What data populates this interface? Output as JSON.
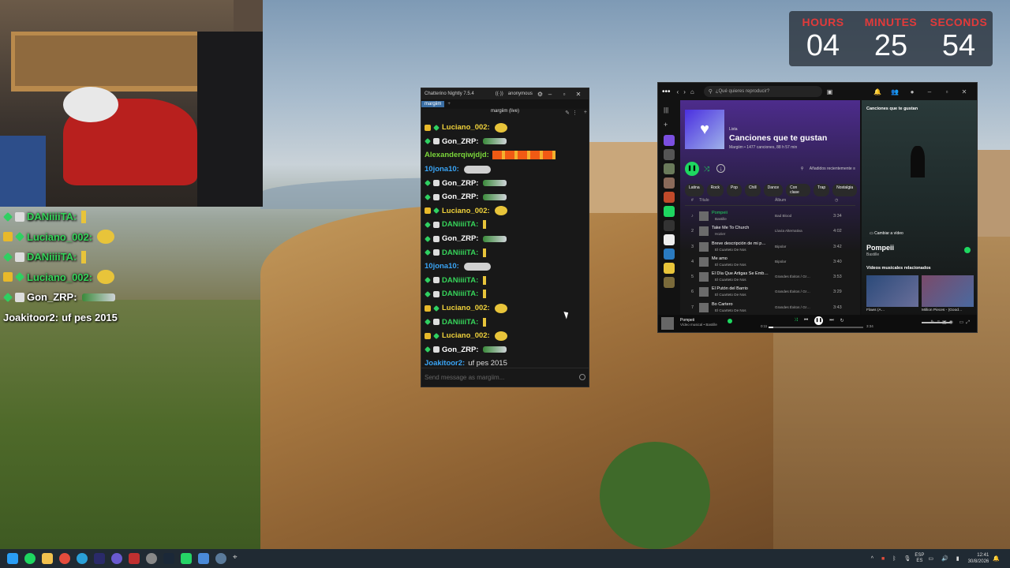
{
  "timer": {
    "hours_label": "HOURS",
    "hours": "04",
    "minutes_label": "MINUTES",
    "minutes": "25",
    "seconds_label": "SECONDS",
    "seconds": "54"
  },
  "overlay_chat": [
    {
      "user": "DANiiiiTA:",
      "color": "green",
      "badges": [
        "diamond",
        "bot"
      ],
      "emote": "slim"
    },
    {
      "user": "Luciano_002:",
      "color": "green",
      "badges": [
        "crown",
        "diamond"
      ],
      "emote": "face"
    },
    {
      "user": "DANiiiiTA:",
      "color": "green",
      "badges": [
        "diamond",
        "bot"
      ],
      "emote": "slim"
    },
    {
      "user": "Luciano_002:",
      "color": "green",
      "badges": [
        "crown",
        "diamond"
      ],
      "emote": "face"
    },
    {
      "user": "Gon_ZRP:",
      "color": "white",
      "badges": [
        "diamond",
        "bot"
      ],
      "emote": "gun"
    },
    {
      "user": "Joakitoor2:",
      "color": "white",
      "badges": [],
      "text": "uf pes 2015"
    }
  ],
  "chatterino": {
    "title": "Chatterino Nightly 7.5.4",
    "account": "anonymous",
    "tab": "margiim",
    "channel": "margiim (live)",
    "input_placeholder": "Send message as margiim...",
    "messages": [
      {
        "user": "Luciano_002:",
        "color": "yellow",
        "badges": [
          "crown",
          "diamond"
        ],
        "emote": "face"
      },
      {
        "user": "Gon_ZRP:",
        "color": "white",
        "badges": [
          "diamond",
          "bot"
        ],
        "emote": "gun"
      },
      {
        "user": "Alexanderqiwjdjd:",
        "color": "lime",
        "badges": [],
        "emote": "fire"
      },
      {
        "user": "10jona10:",
        "color": "blue",
        "badges": [],
        "emote": "cloud"
      },
      {
        "user": "Gon_ZRP:",
        "color": "white",
        "badges": [
          "diamond",
          "bot"
        ],
        "emote": "gun"
      },
      {
        "user": "Gon_ZRP:",
        "color": "white",
        "badges": [
          "diamond",
          "bot"
        ],
        "emote": "gun"
      },
      {
        "user": "Luciano_002:",
        "color": "yellow",
        "badges": [
          "crown",
          "diamond"
        ],
        "emote": "face"
      },
      {
        "user": "DANiiiiTA:",
        "color": "green",
        "badges": [
          "diamond",
          "bot"
        ],
        "emote": "slim"
      },
      {
        "user": "Gon_ZRP:",
        "color": "white",
        "badges": [
          "diamond",
          "bot"
        ],
        "emote": "gun"
      },
      {
        "user": "DANiiiiTA:",
        "color": "green",
        "badges": [
          "diamond",
          "bot"
        ],
        "emote": "slim"
      },
      {
        "user": "10jona10:",
        "color": "blue",
        "badges": [],
        "emote": "cloud"
      },
      {
        "user": "DANiiiiTA:",
        "color": "green",
        "badges": [
          "diamond",
          "bot"
        ],
        "emote": "slim"
      },
      {
        "user": "DANiiiiTA:",
        "color": "green",
        "badges": [
          "diamond",
          "bot"
        ],
        "emote": "slim"
      },
      {
        "user": "Luciano_002:",
        "color": "yellow",
        "badges": [
          "crown",
          "diamond"
        ],
        "emote": "face"
      },
      {
        "user": "DANiiiiTA:",
        "color": "green",
        "badges": [
          "diamond",
          "bot"
        ],
        "emote": "slim"
      },
      {
        "user": "Luciano_002:",
        "color": "yellow",
        "badges": [
          "crown",
          "diamond"
        ],
        "emote": "face"
      },
      {
        "user": "Gon_ZRP:",
        "color": "white",
        "badges": [
          "diamond",
          "bot"
        ],
        "emote": "gun"
      },
      {
        "user": "Joakitoor2:",
        "color": "blue",
        "badges": [],
        "text": "uf pes 2015"
      }
    ]
  },
  "spotify": {
    "search_placeholder": "¿Qué quieres reproducir?",
    "playlist_kind": "Lista",
    "playlist_title": "Canciones que te gustan",
    "playlist_meta": "Margiim • 1477 canciones, 88 h 57 min",
    "sort_label": "Añadidos recientemente",
    "chips": [
      "Latina",
      "Rock",
      "Pop",
      "Chill",
      "Dance",
      "Con clase",
      "Trap",
      "Nostalgia"
    ],
    "header": {
      "num": "#",
      "title": "Título",
      "album": "Álbum"
    },
    "tracks": [
      {
        "num": "♪",
        "title": "Pompeii",
        "artist": "Bastille",
        "album": "Bad Blood",
        "duration": "3:34"
      },
      {
        "num": "2",
        "title": "Take Me To Church",
        "artist": "Hozier",
        "album": "Lluvia Alternativa",
        "duration": "4:02"
      },
      {
        "num": "3",
        "title": "Breve descripción de mi p…",
        "artist": "El Cuarteto De Nos",
        "album": "Bipolar",
        "duration": "3:42"
      },
      {
        "num": "4",
        "title": "Me amo",
        "artist": "El Cuarteto De Nos",
        "album": "Bipolar",
        "duration": "3:40"
      },
      {
        "num": "5",
        "title": "El Día Que Artigas Se Emb…",
        "artist": "El Cuarteto De Nos",
        "album": "Grandes Éxitos / Gr…",
        "duration": "3:53"
      },
      {
        "num": "6",
        "title": "El Putón del Barrio",
        "artist": "El Cuarteto De Nos",
        "album": "Grandes Éxitos / Gr…",
        "duration": "3:29"
      },
      {
        "num": "7",
        "title": "Bo Cartero",
        "artist": "El Cuarteto De Nos",
        "album": "Grandes Éxitos / Gr…",
        "duration": "3:43"
      }
    ],
    "side": {
      "heading": "Canciones que te gustan",
      "video_btn": "Cambiar a vídeo",
      "song": "Pompeii",
      "artist": "Bastille",
      "related_heading": "Vídeos musicales relacionados",
      "related": [
        "Flaws (A…",
        "Million Pieces - (Good…"
      ]
    },
    "now_playing": {
      "song": "Pompeii",
      "artist": "Vídeo musical • Bastille",
      "elapsed": "0:11",
      "total": "3:34",
      "progress": 0.05
    }
  },
  "taskbar": {
    "lang1": "ESP",
    "lang2": "ES",
    "time": "12:41",
    "date": "30/8/2026"
  }
}
